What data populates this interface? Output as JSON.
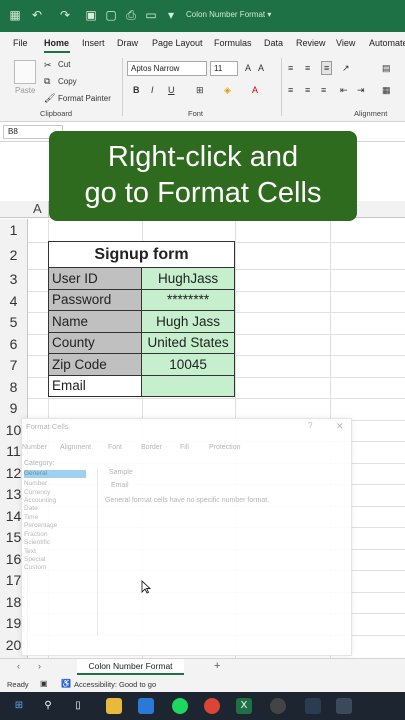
{
  "title_bar": {
    "document_title": "Colon Number Format ▾"
  },
  "ribbon_tabs": [
    "File",
    "Home",
    "Insert",
    "Draw",
    "Page Layout",
    "Formulas",
    "Data",
    "Review",
    "View",
    "Automate"
  ],
  "ribbon": {
    "clipboard": {
      "paste": "Paste",
      "cut": "Cut",
      "copy": "Copy",
      "format_painter": "Format Painter",
      "group_label": "Clipboard"
    },
    "font": {
      "font_name": "Aptos Narrow",
      "font_size": "11",
      "bold": "B",
      "italic": "I",
      "underline": "U",
      "group_label": "Font"
    },
    "alignment": {
      "group_label": "Alignment"
    }
  },
  "formula_bar": {
    "name_box": "B8"
  },
  "columns": [
    "A"
  ],
  "rows": [
    "1",
    "2",
    "3",
    "4",
    "5",
    "6",
    "7",
    "8",
    "9",
    "10",
    "11",
    "12",
    "13",
    "14",
    "15",
    "16",
    "17",
    "18",
    "19",
    "20"
  ],
  "caption": {
    "line1": "Right-click and",
    "line2": "go to Format Cells"
  },
  "form": {
    "title": "Signup form",
    "rows": [
      {
        "label": "User ID",
        "value": "HughJass"
      },
      {
        "label": "Password",
        "value": "********"
      },
      {
        "label": "Name",
        "value": "Hugh Jass"
      },
      {
        "label": "County",
        "value": "United States"
      },
      {
        "label": "Zip Code",
        "value": "10045"
      },
      {
        "label": "Email",
        "value": ""
      }
    ]
  },
  "dialog": {
    "title": "Format Cells",
    "help": "?",
    "close": "✕",
    "tabs": [
      "Number",
      "Alignment",
      "Font",
      "Border",
      "Fill",
      "Protection"
    ],
    "category_label": "Category:",
    "categories": [
      "General",
      "Number",
      "Currency",
      "Accounting",
      "Date",
      "Time",
      "Percentage",
      "Fraction",
      "Scientific",
      "Text",
      "Special",
      "Custom"
    ],
    "sample_label": "Sample",
    "sample_value": "Email",
    "description": "General format cells have no specific number format."
  },
  "sheet_tabs": {
    "active": "Colon Number Format",
    "add": "+"
  },
  "status_bar": {
    "ready": "Ready",
    "accessibility": "Accessibility: Good to go"
  },
  "colors": {
    "excel_green": "#1e7145",
    "caption_bg": "#2e6b1e",
    "value_fill": "#c6efce",
    "label_fill": "#c0c0c0"
  }
}
